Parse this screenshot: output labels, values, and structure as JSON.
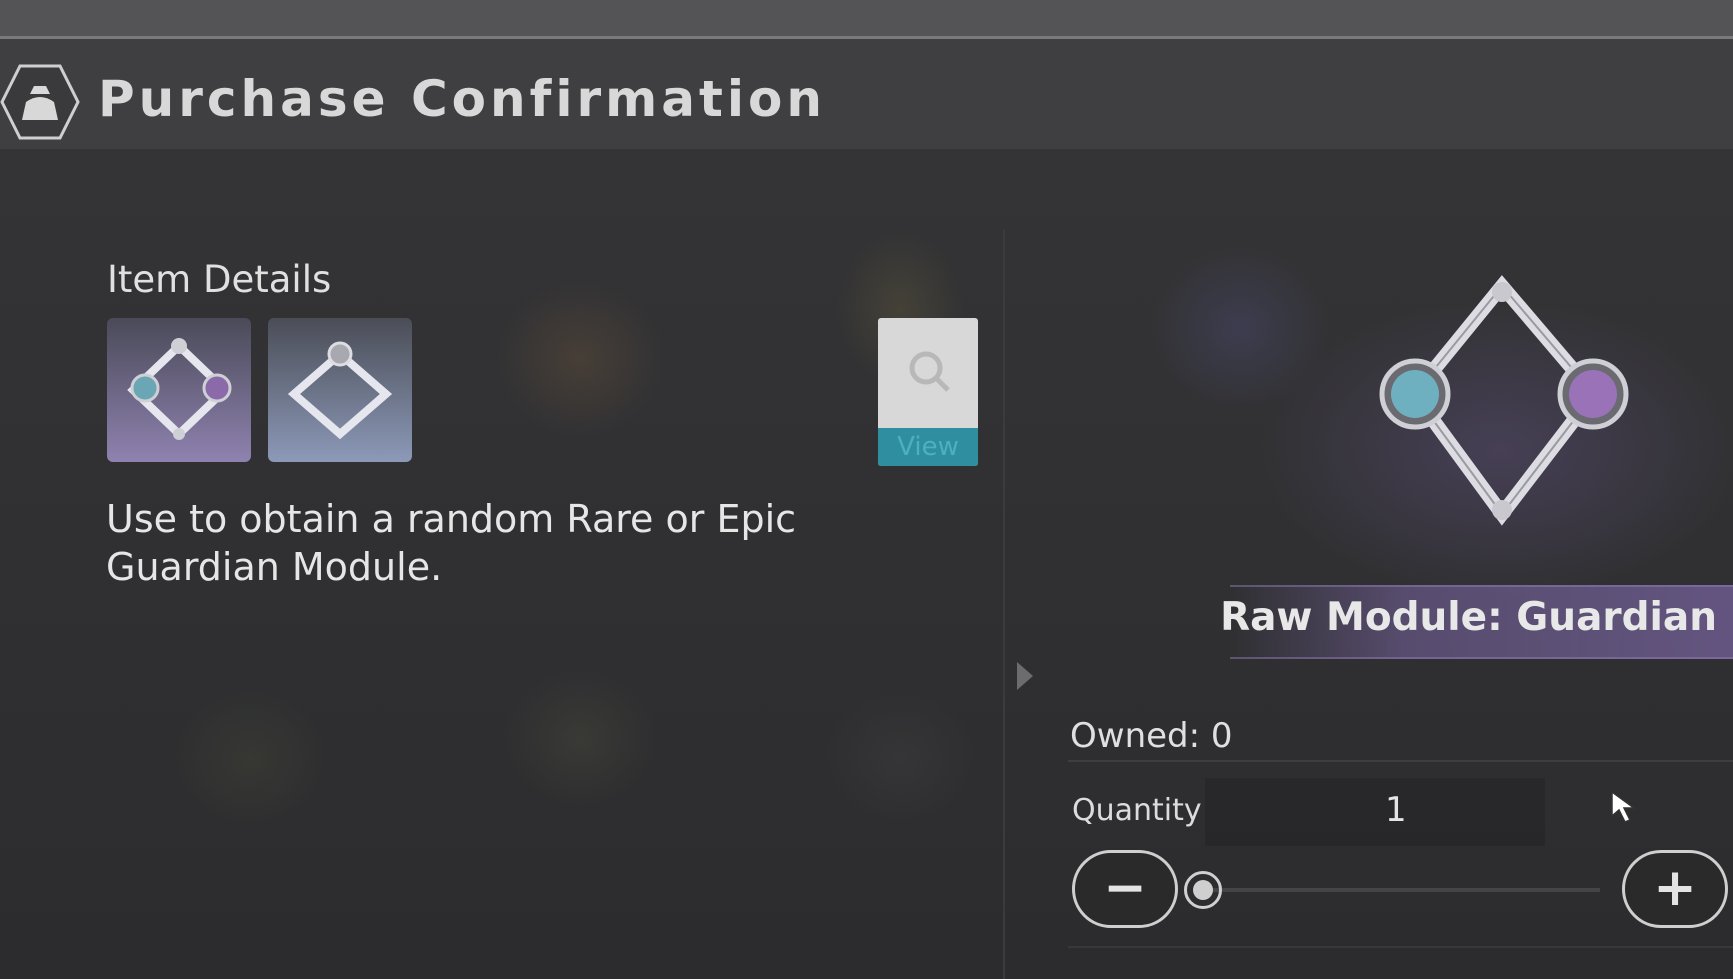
{
  "header": {
    "title": "Purchase Confirmation",
    "icon": "bag-icon"
  },
  "details": {
    "section_label": "Item Details",
    "description": "Use to obtain a random Rare or Epic Guardian Module.",
    "view_label": "View"
  },
  "item": {
    "name": "Raw Module: Guardian",
    "owned": "Owned: 0"
  },
  "quantity": {
    "label": "Quantity",
    "value": "1",
    "minus": "−",
    "plus": "+"
  }
}
